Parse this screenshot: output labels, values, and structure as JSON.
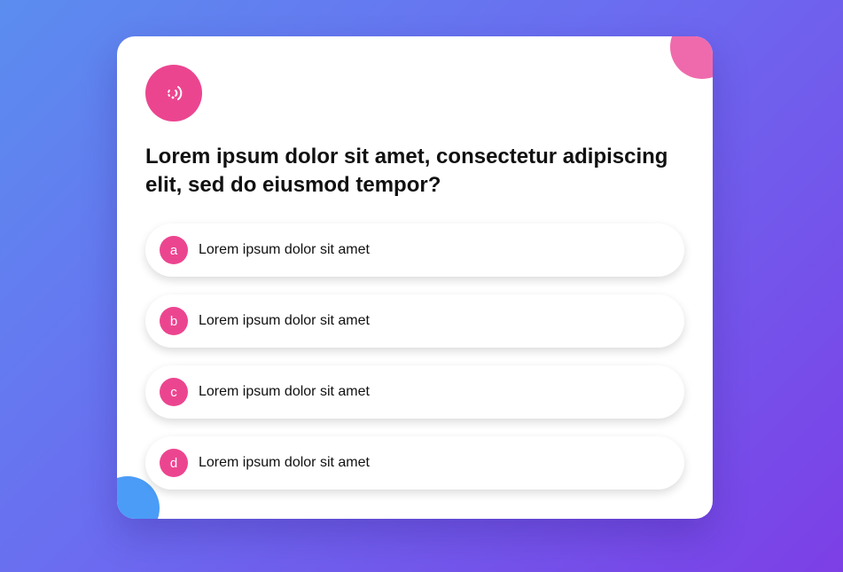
{
  "colors": {
    "accent": "#ec4590",
    "corner_pink": "#ef6aac",
    "corner_blue": "#4b9cf7",
    "background_start": "#5b8def",
    "background_end": "#7c3fe6"
  },
  "logo": {
    "icon": "broadcast-signal-icon"
  },
  "question": {
    "text": "Lorem ipsum dolor sit amet, consectetur adipiscing elit, sed do eiusmod tempor?"
  },
  "options": [
    {
      "letter": "a",
      "label": "Lorem ipsum dolor sit amet"
    },
    {
      "letter": "b",
      "label": "Lorem ipsum dolor sit amet"
    },
    {
      "letter": "c",
      "label": "Lorem ipsum dolor sit amet"
    },
    {
      "letter": "d",
      "label": "Lorem ipsum dolor sit amet"
    }
  ]
}
